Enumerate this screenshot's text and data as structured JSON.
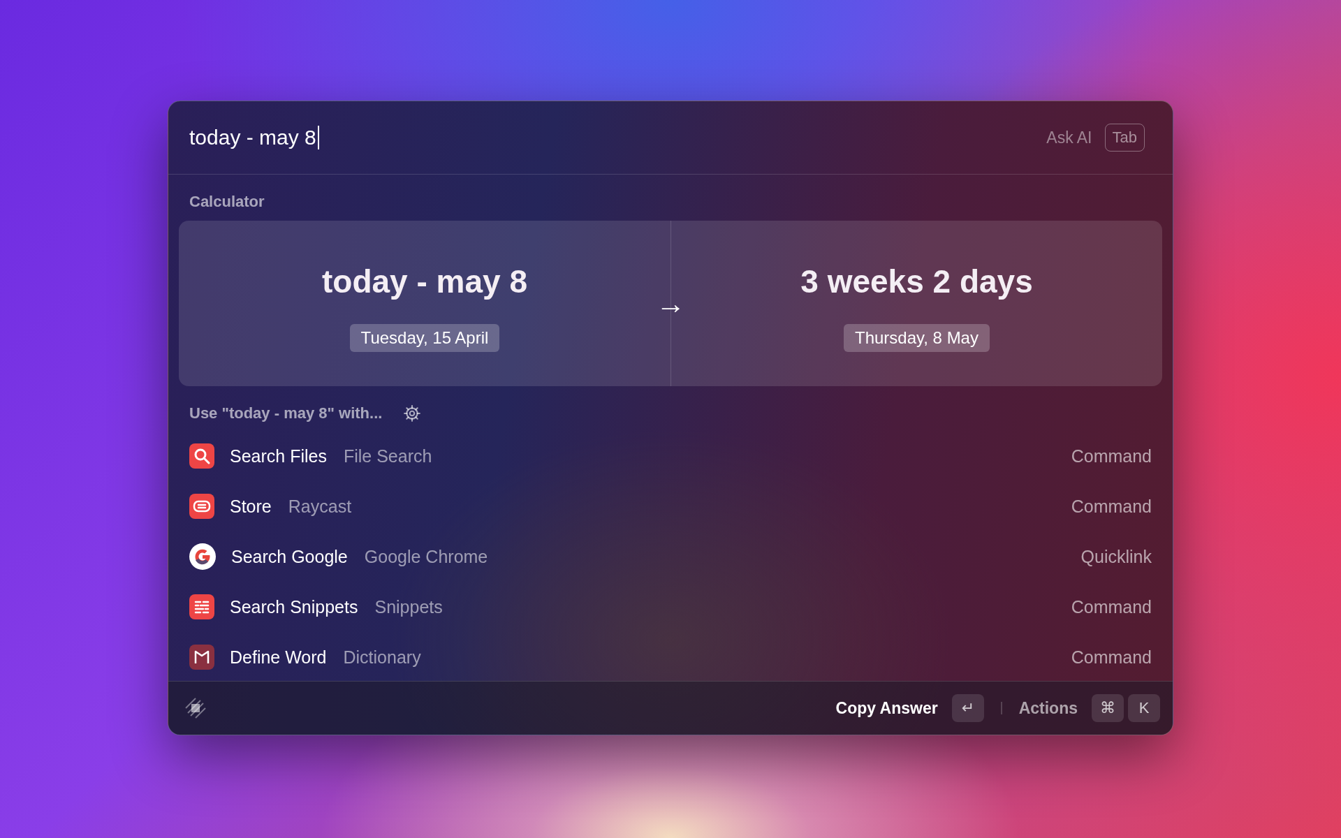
{
  "search": {
    "value": "today - may 8"
  },
  "ask_ai": {
    "label": "Ask AI",
    "key": "Tab"
  },
  "section_title": "Calculator",
  "calculation": {
    "input": "today - may 8",
    "input_date": "Tuesday, 15 April",
    "arrow": "→",
    "result": "3 weeks 2 days",
    "result_date": "Thursday, 8 May"
  },
  "use_with": "Use \"today - may 8\" with...",
  "results": [
    {
      "kind": "files",
      "title": "Search Files",
      "subtitle": "File Search",
      "type": "Command"
    },
    {
      "kind": "store",
      "title": "Store",
      "subtitle": "Raycast",
      "type": "Command"
    },
    {
      "kind": "google",
      "title": "Search Google",
      "subtitle": "Google Chrome",
      "type": "Quicklink"
    },
    {
      "kind": "snippets",
      "title": "Search Snippets",
      "subtitle": "Snippets",
      "type": "Command"
    },
    {
      "kind": "dictionary",
      "title": "Define Word",
      "subtitle": "Dictionary",
      "type": "Command"
    }
  ],
  "footer": {
    "primary_action": "Copy Answer",
    "primary_key": "↵",
    "actions_label": "Actions",
    "action_keys": [
      "⌘",
      "K"
    ]
  }
}
